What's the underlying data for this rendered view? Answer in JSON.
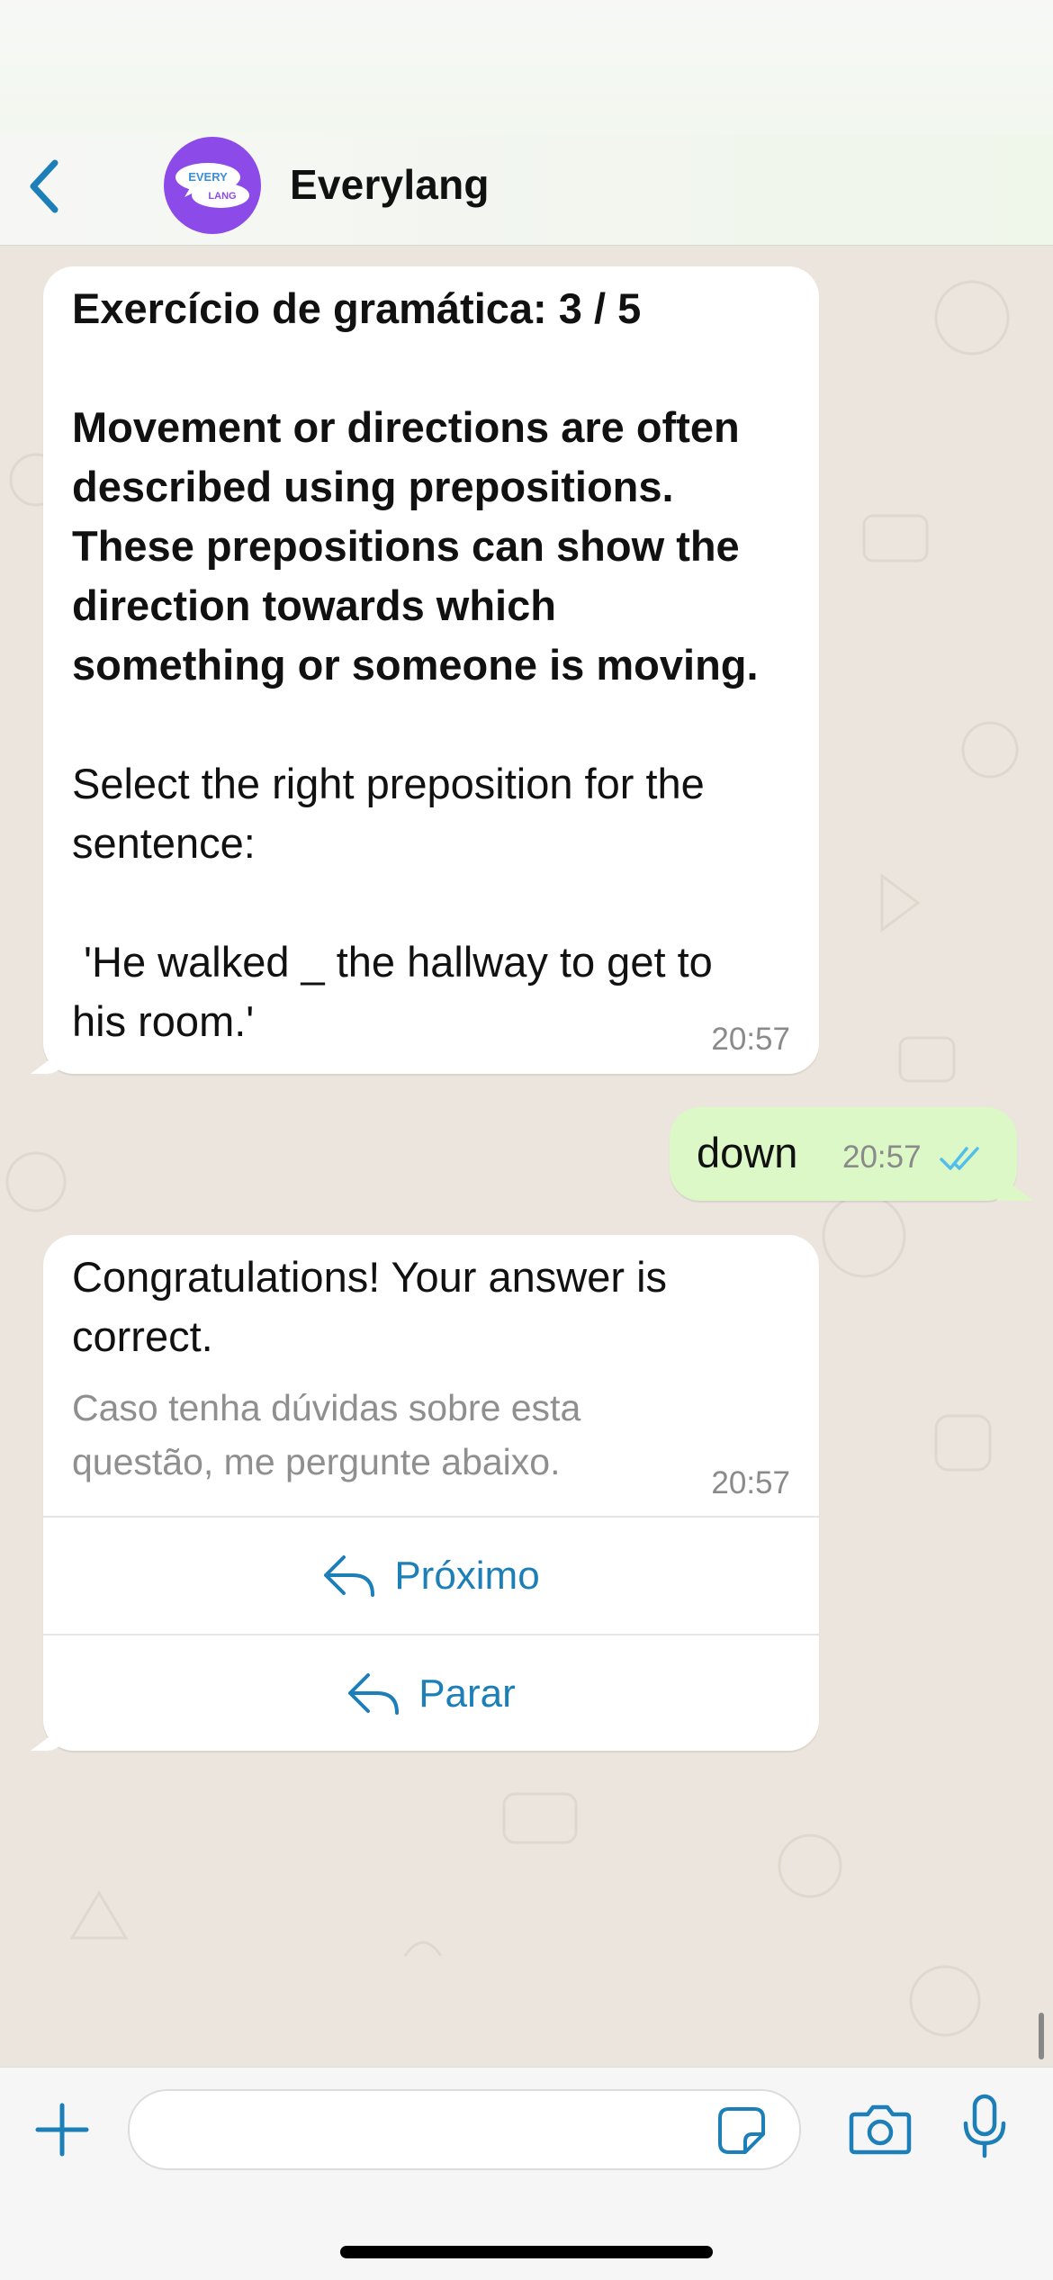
{
  "header": {
    "contact_name": "Everylang",
    "avatar_text_top": "EVERY",
    "avatar_text_bottom": "LANG"
  },
  "messages": [
    {
      "direction": "in",
      "title": "Exercício de gramática: 3 / 5",
      "bold_lines": [
        "Movement or directions are often",
        "described using prepositions.",
        "These prepositions can show the",
        "direction towards which",
        "something or someone is moving."
      ],
      "prompt_lines": [
        "Select the right preposition for the",
        "sentence:"
      ],
      "sentence_lines": [
        " 'He walked _ the hallway to get to",
        "his room.'"
      ],
      "time": "20:57"
    },
    {
      "direction": "out",
      "text": "down",
      "time": "20:57",
      "status": "read"
    },
    {
      "direction": "in",
      "text_lines": [
        "Congratulations! Your answer is",
        "correct."
      ],
      "caption_lines": [
        "Caso tenha dúvidas sobre esta",
        "questão, me pergunte abaixo."
      ],
      "time": "20:57",
      "buttons": [
        "Próximo",
        "Parar"
      ]
    }
  ],
  "colors": {
    "accent": "#1c7fb8",
    "outgoing_bubble": "#dcf8c6",
    "avatar": "#8c4be8",
    "read_ticks": "#53bdeb"
  },
  "icons": {
    "back": "chevron-left-icon",
    "reply": "reply-arrow-icon",
    "add": "plus-icon",
    "sticker": "sticker-icon",
    "camera": "camera-icon",
    "mic": "microphone-icon"
  }
}
